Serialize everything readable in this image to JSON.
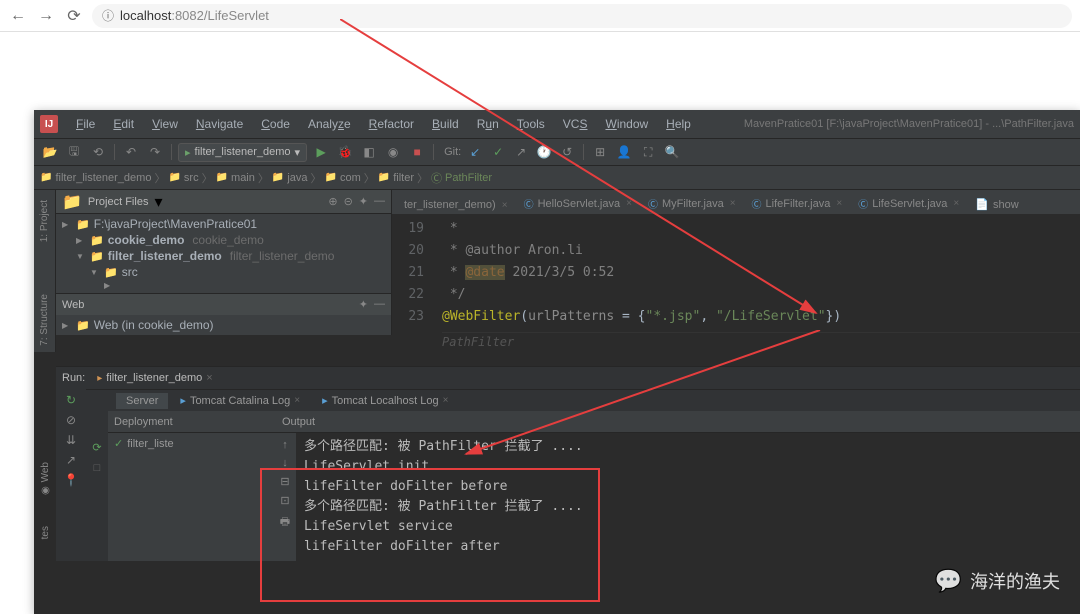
{
  "browser": {
    "url_host": "localhost",
    "url_port": ":8082",
    "url_path": "/LifeServlet"
  },
  "ide": {
    "title": "MavenPratice01 [F:\\javaProject\\MavenPratice01] - ...\\PathFilter.java",
    "menus": [
      "File",
      "Edit",
      "View",
      "Navigate",
      "Code",
      "Analyze",
      "Refactor",
      "Build",
      "Run",
      "Tools",
      "VCS",
      "Window",
      "Help"
    ],
    "run_config": "filter_listener_demo",
    "git_label": "Git:",
    "breadcrumb": [
      "filter_listener_demo",
      "src",
      "main",
      "java",
      "com",
      "filter",
      "PathFilter"
    ],
    "project_panel": {
      "title": "Project Files",
      "tree": [
        {
          "label": "F:\\javaProject\\MavenPratice01",
          "icon": "folder"
        },
        {
          "label": "cookie_demo",
          "muted": "cookie_demo",
          "indent": 1
        },
        {
          "label": "filter_listener_demo",
          "muted": "filter_listener_demo",
          "indent": 1
        },
        {
          "label": "src",
          "indent": 2
        }
      ],
      "web_title": "Web",
      "web_item": "Web (in cookie_demo)"
    },
    "editor": {
      "tabs": [
        {
          "label": "ter_listener_demo)",
          "icon": "pom"
        },
        {
          "label": "HelloServlet.java",
          "icon": "java"
        },
        {
          "label": "MyFilter.java",
          "icon": "java"
        },
        {
          "label": "LifeFilter.java",
          "icon": "java"
        },
        {
          "label": "LifeServlet.java",
          "icon": "java"
        },
        {
          "label": "show",
          "icon": "jsp"
        }
      ],
      "lines": {
        "19": " *",
        "20": " * @author Aron.li",
        "21_pre": " * ",
        "21_tag": "@date",
        "21_post": " 2021/3/5 0:52",
        "22": " */",
        "23_anno": "@WebFilter",
        "23_p1": "(",
        "23_param": "urlPatterns",
        "23_eq": " = {",
        "23_s1": "\"*.jsp\"",
        "23_c": ", ",
        "23_s2": "\"/LifeServlet\"",
        "23_end": "})"
      },
      "hint": "PathFilter"
    },
    "run": {
      "label": "Run:",
      "tab": "filter_listener_demo",
      "subtabs": [
        "Server",
        "Tomcat Catalina Log",
        "Tomcat Localhost Log"
      ],
      "deploy_header": "Deployment",
      "deploy_item": "filter_liste",
      "output_header": "Output",
      "console": [
        "多个路径匹配: 被 PathFilter 拦截了 ....",
        "LifeServlet init",
        "lifeFilter doFilter before",
        "多个路径匹配: 被 PathFilter 拦截了 ....",
        "LifeServlet service",
        "lifeFilter doFilter after"
      ]
    }
  },
  "watermark": "海洋的渔夫"
}
